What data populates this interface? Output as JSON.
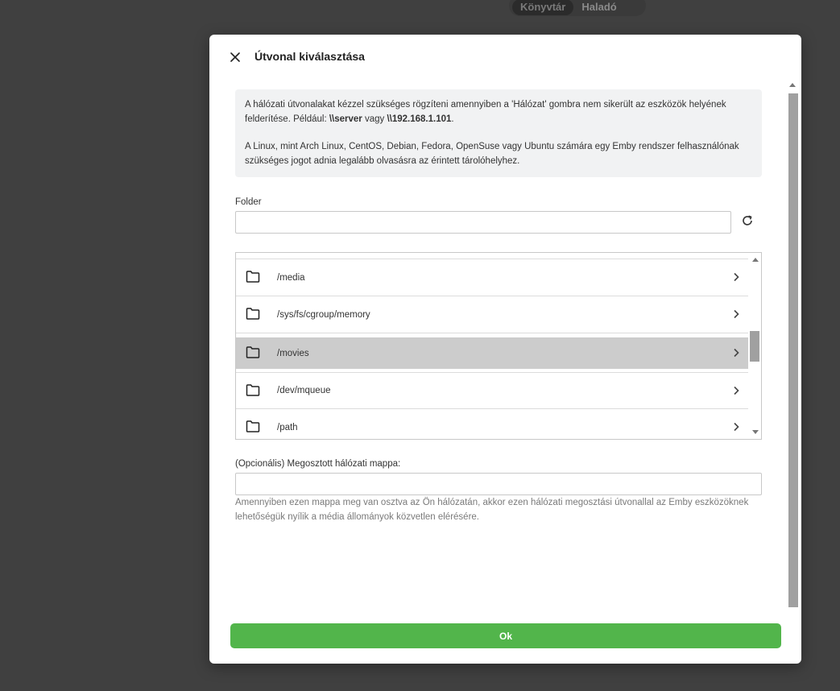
{
  "background": {
    "tabs": [
      {
        "label": "Könyvtár",
        "active": true
      },
      {
        "label": "Haladó",
        "active": false
      }
    ]
  },
  "dialog": {
    "title": "Útvonal kiválasztása",
    "info": {
      "p1_a": "A hálózati útvonalakat kézzel szükséges rögzíteni amennyiben a 'Hálózat' gombra nem sikerült az eszközök helyének felderítése. Például: ",
      "p1_server": "\\\\server",
      "p1_mid": " vagy ",
      "p1_ip": "\\\\192.168.1.101",
      "p1_end": ".",
      "p2": "A Linux, mint Arch Linux, CentOS, Debian, Fedora, OpenSuse vagy Ubuntu számára egy Emby rendszer felhasználónak szükséges jogot adnia legalább olvasásra az érintett tárolóhelyhez."
    },
    "folder_label": "Folder",
    "folder_value": "",
    "directories": [
      {
        "name": "/media",
        "selected": false
      },
      {
        "name": "/sys/fs/cgroup/memory",
        "selected": false
      },
      {
        "name": "/movies",
        "selected": true
      },
      {
        "name": "/dev/mqueue",
        "selected": false
      },
      {
        "name": "/path",
        "selected": false
      }
    ],
    "share_label": "(Opcionális) Megosztott hálózati mappa:",
    "share_value": "",
    "share_help": "Amennyiben ezen mappa meg van osztva az Ön hálózatán, akkor ezen hálózati megosztási útvonallal az Emby eszközöknek lehetőségük nyílik a média állományok közvetlen elérésére.",
    "ok_label": "Ok"
  },
  "colors": {
    "accent": "#52b54b",
    "selected_row": "#cccccc",
    "overlay": "#404040"
  },
  "icons": [
    "close-icon",
    "refresh-icon",
    "folder-icon",
    "chevron-right-icon"
  ]
}
